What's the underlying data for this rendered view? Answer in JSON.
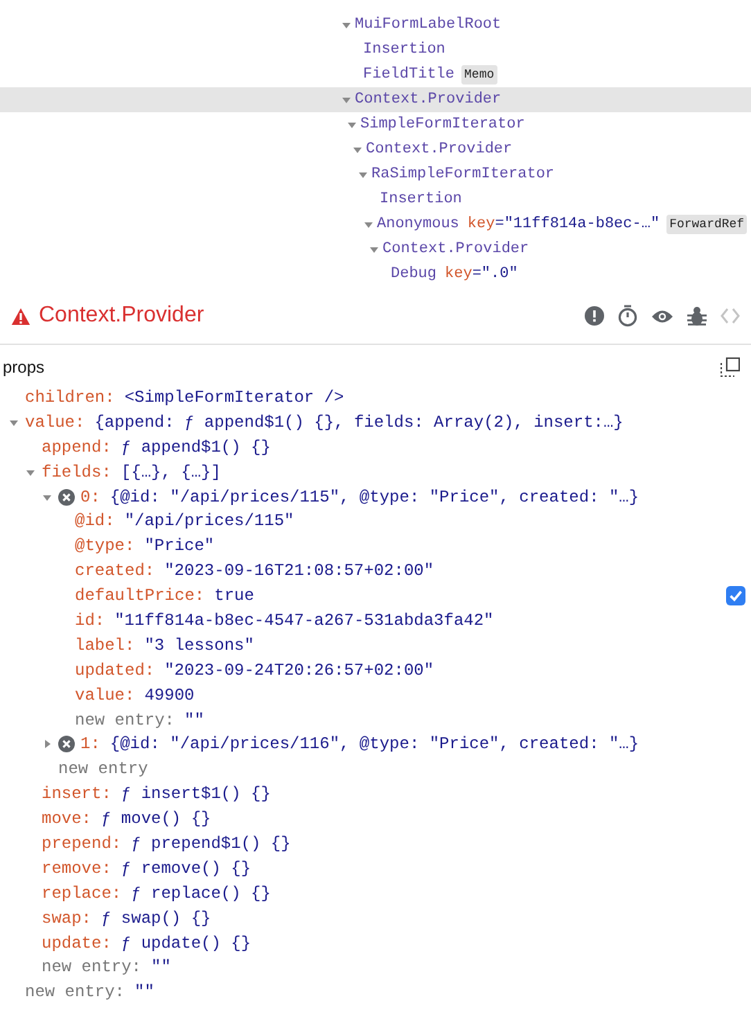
{
  "component_tree": [
    {
      "name": "MuiFormLabelRoot",
      "expanded": true,
      "selected": false,
      "children": [
        {
          "name": "Insertion",
          "selected": false
        },
        {
          "name": "FieldTitle",
          "badge": "Memo",
          "selected": false
        }
      ]
    },
    {
      "name": "Context.Provider",
      "expanded": true,
      "selected": true,
      "children": [
        {
          "name": "SimpleFormIterator",
          "expanded": true,
          "selected": false,
          "children": [
            {
              "name": "Context.Provider",
              "expanded": true,
              "selected": false,
              "children": [
                {
                  "name": "RaSimpleFormIterator",
                  "expanded": true,
                  "selected": false,
                  "children": [
                    {
                      "name": "Insertion",
                      "selected": false
                    },
                    {
                      "name": "Anonymous",
                      "key_name": "key",
                      "key_value": "=\"11ff814a-b8ec-…\"",
                      "badge": "ForwardRef",
                      "expanded": true,
                      "selected": false,
                      "children": [
                        {
                          "name": "Context.Provider",
                          "expanded": true,
                          "selected": false,
                          "children": [
                            {
                              "name": "Debug",
                              "key_name": "key",
                              "key_value": "=\".0\"",
                              "selected": false
                            }
                          ]
                        }
                      ]
                    }
                  ]
                }
              ]
            }
          ]
        }
      ]
    }
  ],
  "inspector": {
    "title": "Context.Provider",
    "warning": true
  },
  "props": {
    "label": "props",
    "entries": [
      {
        "kind": "prop",
        "name": "children:",
        "value": "<SimpleFormIterator />"
      },
      {
        "kind": "prop",
        "name": "value:",
        "value": "{append: ƒ append$1() {}, fields: Array(2), insert:…}",
        "expanded": true,
        "children": [
          {
            "kind": "prop",
            "name": "append:",
            "value": "ƒ append$1() {}"
          },
          {
            "kind": "prop",
            "name": "fields:",
            "value": "[{…}, {…}]",
            "expanded": true,
            "children": [
              {
                "kind": "prop",
                "name": "0:",
                "removable": true,
                "value": "{@id: \"/api/prices/115\", @type: \"Price\", created: \"…}",
                "expanded": true,
                "children": [
                  {
                    "kind": "prop",
                    "name": "@id:",
                    "value": "\"/api/prices/115\""
                  },
                  {
                    "kind": "prop",
                    "name": "@type:",
                    "value": "\"Price\""
                  },
                  {
                    "kind": "prop",
                    "name": "created:",
                    "value": "\"2023-09-16T21:08:57+02:00\""
                  },
                  {
                    "kind": "boolean",
                    "name": "defaultPrice:",
                    "value": "true",
                    "checked": true
                  },
                  {
                    "kind": "prop",
                    "name": "id:",
                    "value": "\"11ff814a-b8ec-4547-a267-531abda3fa42\""
                  },
                  {
                    "kind": "prop",
                    "name": "label:",
                    "value": "\"3 lessons\""
                  },
                  {
                    "kind": "prop",
                    "name": "updated:",
                    "value": "\"2023-09-24T20:26:57+02:00\""
                  },
                  {
                    "kind": "prop",
                    "name": "value:",
                    "value": "49900"
                  },
                  {
                    "kind": "new-entry",
                    "name": "new entry:",
                    "value": "\"\""
                  }
                ]
              },
              {
                "kind": "prop",
                "name": "1:",
                "removable": true,
                "value": "{@id: \"/api/prices/116\", @type: \"Price\", created: \"…}",
                "expanded": false
              },
              {
                "kind": "new-entry",
                "name": "new entry"
              }
            ]
          },
          {
            "kind": "prop",
            "name": "insert:",
            "value": "ƒ insert$1() {}"
          },
          {
            "kind": "prop",
            "name": "move:",
            "value": "ƒ move() {}"
          },
          {
            "kind": "prop",
            "name": "prepend:",
            "value": "ƒ prepend$1() {}"
          },
          {
            "kind": "prop",
            "name": "remove:",
            "value": "ƒ remove() {}"
          },
          {
            "kind": "prop",
            "name": "replace:",
            "value": "ƒ replace() {}"
          },
          {
            "kind": "prop",
            "name": "swap:",
            "value": "ƒ swap() {}"
          },
          {
            "kind": "prop",
            "name": "update:",
            "value": "ƒ update() {}"
          },
          {
            "kind": "new-entry",
            "name": "new entry:",
            "value": "\"\""
          }
        ]
      },
      {
        "kind": "new-entry",
        "name": "new entry:",
        "value": "\"\""
      }
    ]
  }
}
